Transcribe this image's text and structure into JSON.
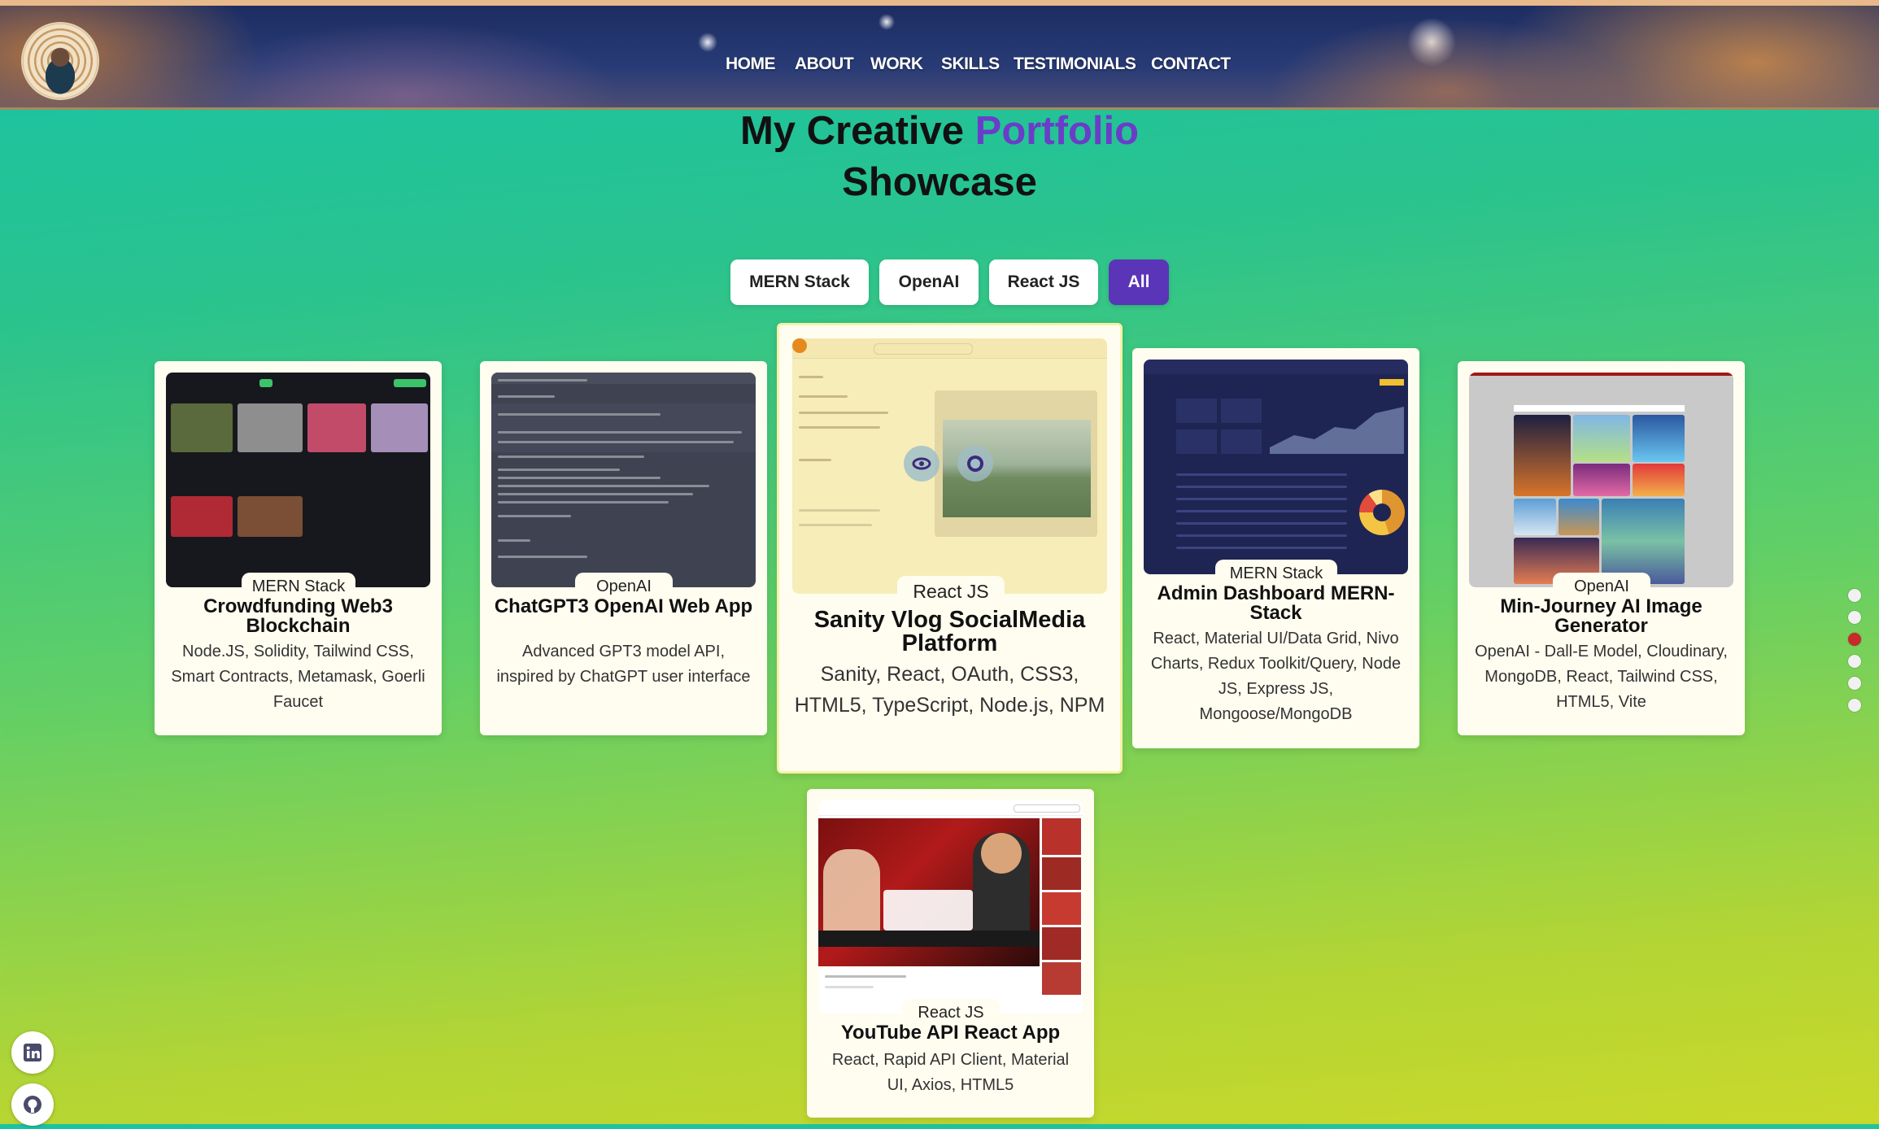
{
  "nav": {
    "links": [
      "HOME",
      "ABOUT",
      "WORK",
      "SKILLS",
      "TESTIMONIALS",
      "CONTACT"
    ]
  },
  "title": {
    "line1_prefix": "My Creative ",
    "line1_accent": "Portfolio",
    "line2": "Showcase"
  },
  "filters": [
    "MERN Stack",
    "OpenAI",
    "React JS",
    "All"
  ],
  "active_filter": "All",
  "projects": [
    {
      "tag": "MERN Stack",
      "title": "Crowdfunding Web3 Blockchain",
      "desc": "Node.JS, Solidity, Tailwind CSS, Smart Contracts, Metamask, Goerli Faucet"
    },
    {
      "tag": "OpenAI",
      "title": "ChatGPT3 OpenAI Web App",
      "desc": "Advanced GPT3 model API, inspired by ChatGPT user interface"
    },
    {
      "tag": "React JS",
      "title": "Sanity Vlog SocialMedia Platform",
      "desc": "Sanity, React, OAuth, CSS3, HTML5, TypeScript, Node.js, NPM"
    },
    {
      "tag": "MERN Stack",
      "title": "Admin Dashboard MERN-Stack",
      "desc": "React, Material UI/Data Grid, Nivo Charts, Redux Toolkit/Query, Node JS, Express JS, Mongoose/MongoDB"
    },
    {
      "tag": "OpenAI",
      "title": "Min-Journey AI Image Generator",
      "desc": "OpenAI - Dall-E Model, Cloudinary, MongoDB, React, Tailwind CSS, HTML5, Vite"
    },
    {
      "tag": "React JS",
      "title": "YouTube API React App",
      "desc": "React, Rapid API Client, Material UI, Axios, HTML5"
    }
  ],
  "side_dots": {
    "count": 6,
    "active_index": 2
  },
  "icons": [
    "eye-icon",
    "github-icon",
    "linkedin-icon"
  ],
  "colors": {
    "accent": "#6a3dc9",
    "active_filter_bg": "#5b35b8",
    "active_dot": "#c62a2a"
  }
}
